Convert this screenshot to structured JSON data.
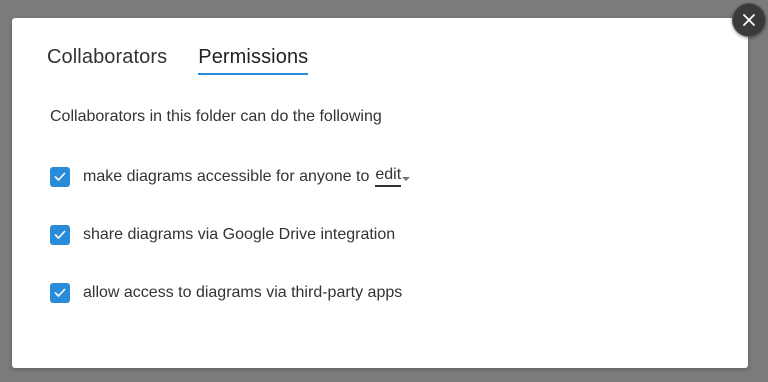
{
  "tabs": [
    {
      "label": "Collaborators",
      "active": false
    },
    {
      "label": "Permissions",
      "active": true
    }
  ],
  "permissions": {
    "intro": "Collaborators in this folder can do the following",
    "options": [
      {
        "label": "make diagrams accessible for anyone to",
        "checked": true,
        "dropdown_value": "edit"
      },
      {
        "label": "share diagrams via Google Drive integration",
        "checked": true
      },
      {
        "label": "allow access to diagrams via third-party apps",
        "checked": true
      }
    ]
  },
  "icons": {
    "close": "close-icon",
    "check": "check-icon",
    "caret": "chevron-down-icon"
  },
  "colors": {
    "accent": "#2a8bd9",
    "backdrop": "#7b7b7b",
    "close_button": "#3a3a3a"
  }
}
